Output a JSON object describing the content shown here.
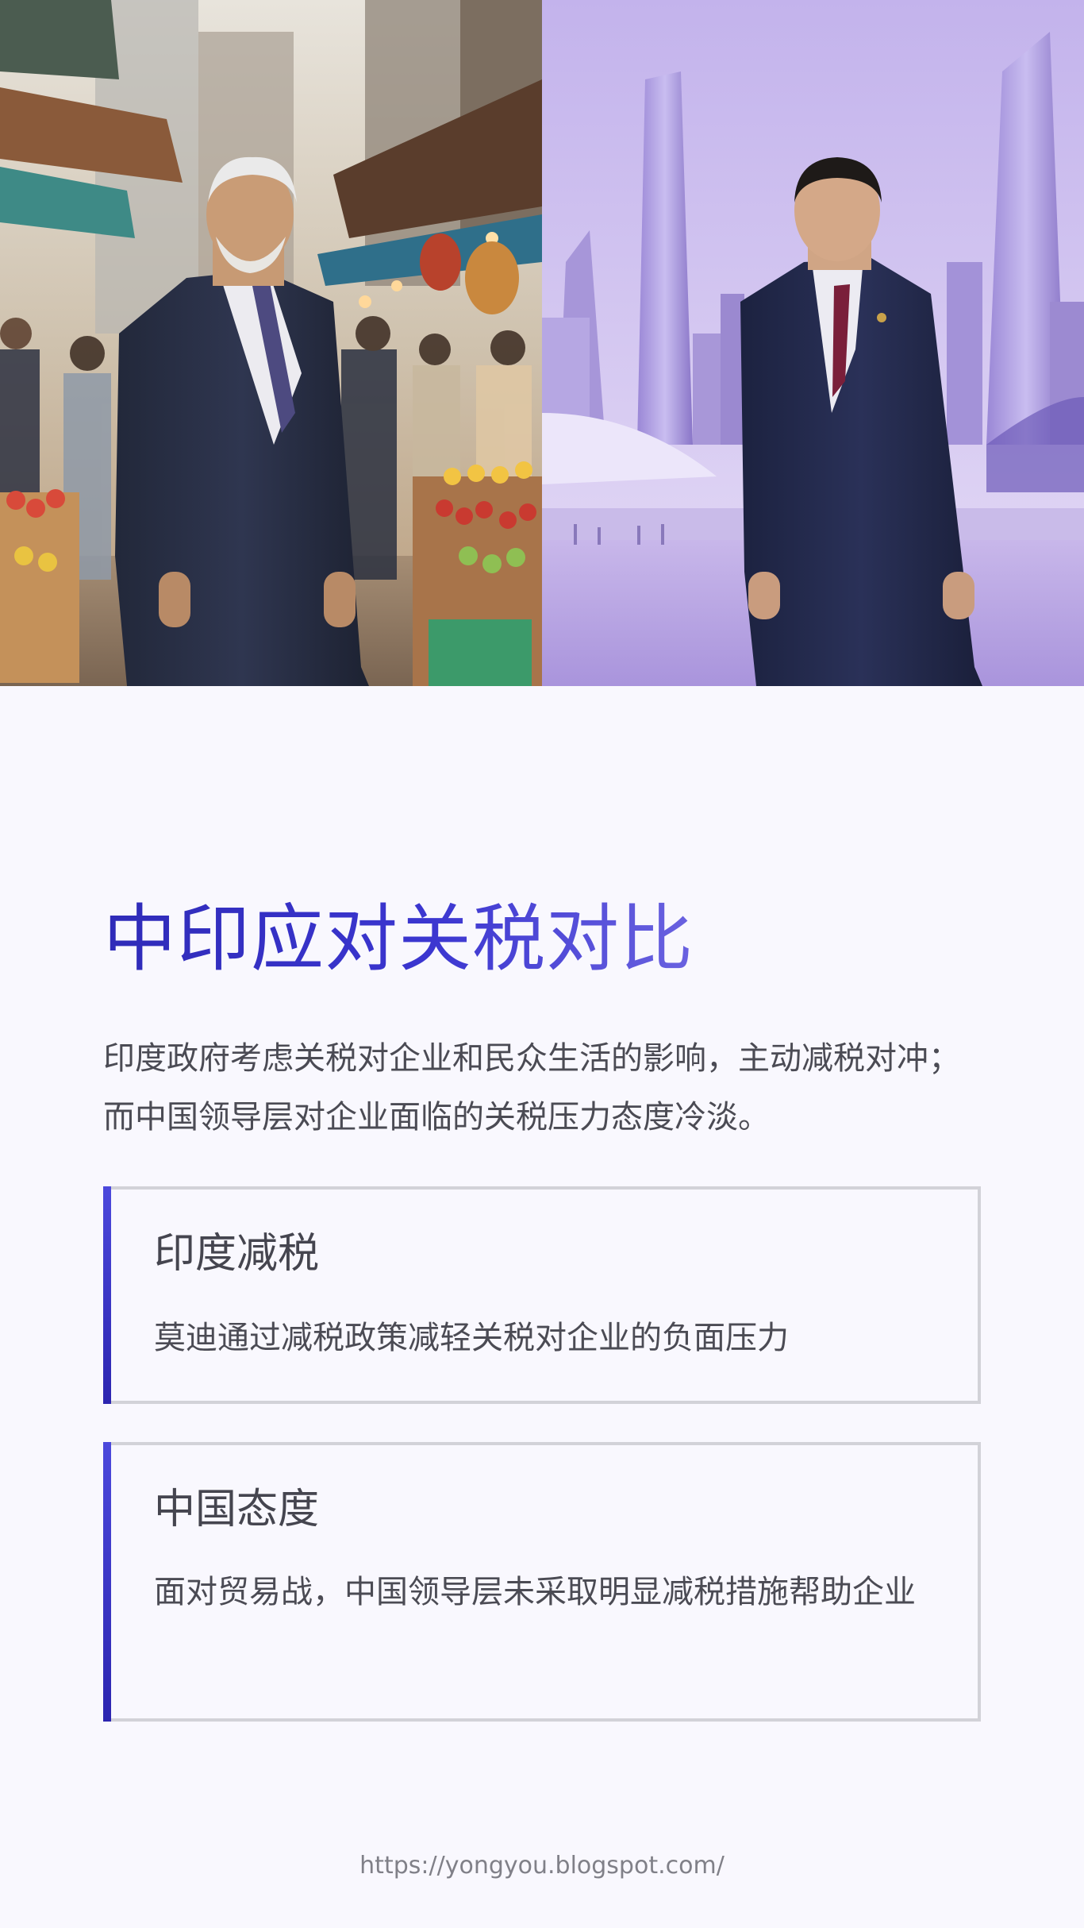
{
  "hero": {
    "left_scene": "indian-leader-market-photo",
    "right_scene": "chinese-leader-skyline-photo"
  },
  "title": "中印应对关税对比",
  "intro": "印度政府考虑关税对企业和民众生活的影响，主动减税对冲；而中国领导层对企业面临的关税压力态度冷淡。",
  "cards": [
    {
      "title": "印度减税",
      "text": "莫迪通过减税政策减轻关税对企业的负面压力"
    },
    {
      "title": "中国态度",
      "text": "面对贸易战，中国领导层未采取明显减税措施帮助企业"
    }
  ],
  "footer": {
    "url": "https://yongyou.blogspot.com/"
  },
  "colors": {
    "accent": "#3b36d0",
    "card_border": "#d2d2d8",
    "background": "#f9f8fe"
  }
}
